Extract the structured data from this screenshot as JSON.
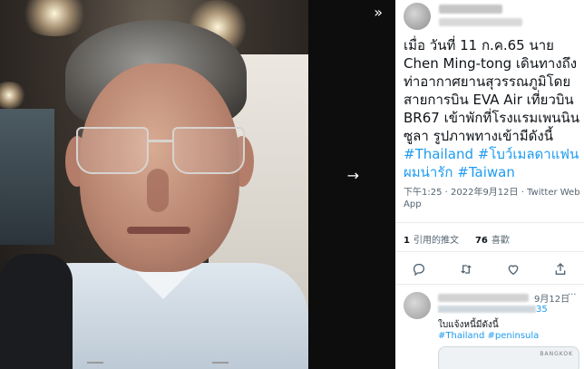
{
  "viewer": {
    "next_icon": "chevron-double-right-icon",
    "arrow_icon": "arrow-right-icon"
  },
  "tweet": {
    "body_plain": "เมื่อ วันที่ 11 ก.ค.65 นาย Chen Ming-tong  เดินทางถึงท่าอากาศยานสุวรรณภูมิโดยสายการบิน EVA Air เที่ยวบิน BR67 เข้าพักที่โรงแรมเพนนินซูลา รูปภาพทางเข้ามีดังนี้",
    "tags": [
      "#Thailand",
      "#โบว์เมลดาแฟนผมน่ารัก",
      "#Taiwan"
    ],
    "timestamp": "下午1:25 · 2022年9月12日 · Twitter Web App",
    "quote_count": "1",
    "quote_label": "引用的推文",
    "like_count": "76",
    "like_label": "喜歡"
  },
  "reply": {
    "date": "9月12日",
    "more": "···",
    "handle_suffix": "35",
    "text": "ใบแจ้งหนี้มีดังนี้",
    "tags": "#Thailand #peninsula",
    "card_text": "BANGKOK"
  }
}
